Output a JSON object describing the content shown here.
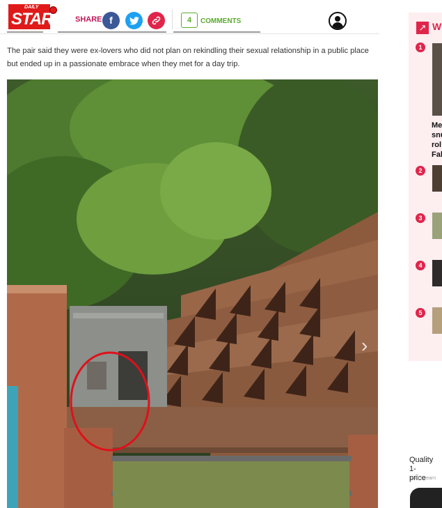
{
  "header": {
    "logo_top": "DAILY",
    "logo_main": "STAR",
    "share_label": "SHARE",
    "facebook_glyph": "f",
    "twitter_glyph": "t",
    "link_glyph": "🔗",
    "comment_count": "4",
    "comments_label": "COMMENTS"
  },
  "article": {
    "paragraph": "The pair said they were ex-lovers who did not plan on rekindling their sexual relationship in a public place but ended up in a passionate embrace when they met for a day trip.",
    "next_glyph": "›"
  },
  "sidebar": {
    "title": "W",
    "trend_glyph": "↗",
    "items": [
      {
        "rank": "1",
        "lines": [
          "Me",
          "snu",
          "rol",
          "Fal"
        ]
      },
      {
        "rank": "2"
      },
      {
        "rank": "3"
      },
      {
        "rank": "4"
      },
      {
        "rank": "5"
      }
    ]
  },
  "ad": {
    "title_line1": "Quality 1-",
    "title_line2": "price",
    "source": "italki - Learn"
  },
  "colors": {
    "brand_red": "#e01a1a",
    "share_pink": "#c2185b",
    "comments_green": "#5aab2c",
    "facebook": "#3b5998",
    "twitter": "#1da1f2",
    "trending_pink": "#e0254b",
    "highlight_circle": "#e0101a"
  },
  "icons": [
    "facebook-icon",
    "twitter-icon",
    "link-icon",
    "user-icon",
    "chevron-right-icon",
    "trending-icon"
  ]
}
